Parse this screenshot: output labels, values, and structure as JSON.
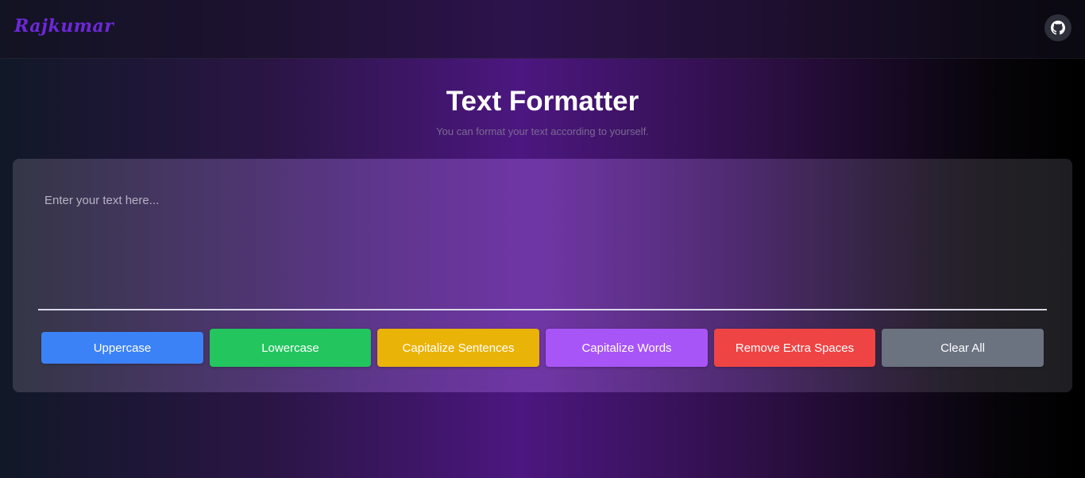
{
  "navbar": {
    "brand": "Rajkumar",
    "github_icon": "github-icon"
  },
  "main": {
    "title": "Text Formatter",
    "subtitle": "You can format your text according to yourself."
  },
  "editor": {
    "placeholder": "Enter your text here...",
    "value": ""
  },
  "buttons": [
    {
      "label": "Uppercase",
      "color": "#3b82f6"
    },
    {
      "label": "Lowercase",
      "color": "#22c55e"
    },
    {
      "label": "Capitalize Sentences",
      "color": "#eab308"
    },
    {
      "label": "Capitalize Words",
      "color": "#a855f7"
    },
    {
      "label": "Remove Extra Spaces",
      "color": "#ef4444"
    },
    {
      "label": "Clear All",
      "color": "#6b7280"
    }
  ],
  "colors": {
    "brand": "#6d28d9",
    "accent_purple": "#4c1780"
  }
}
